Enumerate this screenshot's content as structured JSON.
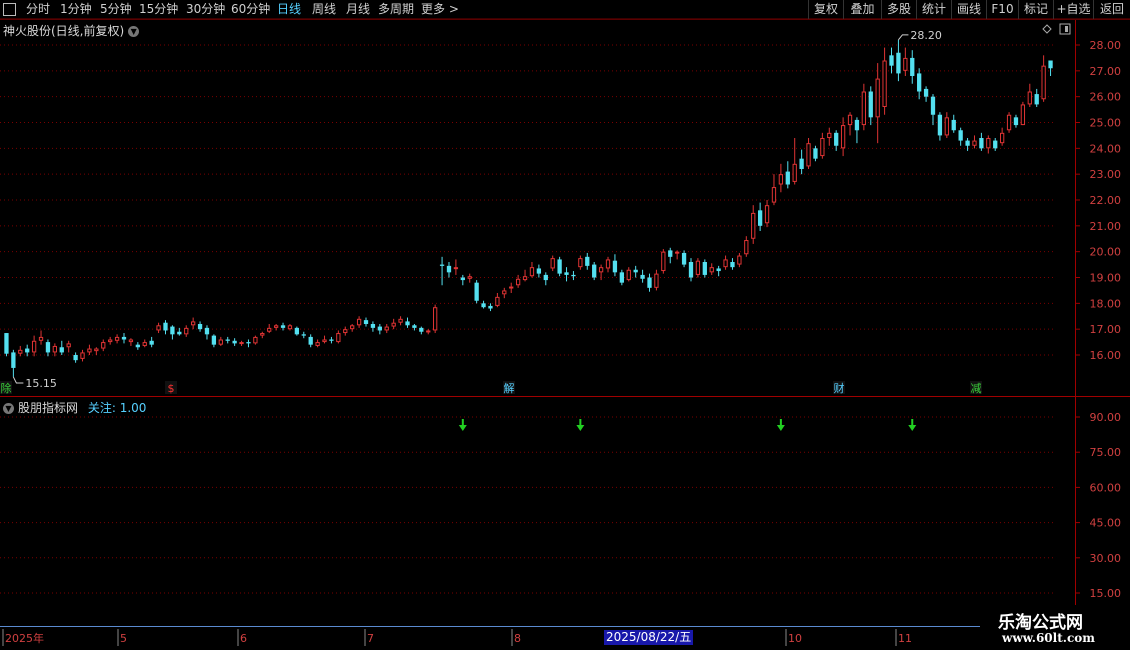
{
  "toolbar": {
    "left": [
      {
        "name": "tab-1min-timeline",
        "label": "分时",
        "active": false
      },
      {
        "name": "tab-1min",
        "label": "1分钟",
        "active": false
      },
      {
        "name": "tab-5min",
        "label": "5分钟",
        "active": false
      },
      {
        "name": "tab-15min",
        "label": "15分钟",
        "active": false
      },
      {
        "name": "tab-30min",
        "label": "30分钟",
        "active": false
      },
      {
        "name": "tab-60min",
        "label": "60分钟",
        "active": false
      },
      {
        "name": "tab-daily",
        "label": "日线",
        "active": true
      },
      {
        "name": "tab-weekly",
        "label": "周线",
        "active": false
      },
      {
        "name": "tab-monthly",
        "label": "月线",
        "active": false
      },
      {
        "name": "tab-multi-period",
        "label": "多周期",
        "active": false
      },
      {
        "name": "tab-more",
        "label": "更多 >",
        "active": false
      }
    ],
    "right": [
      {
        "name": "restore-rights-button",
        "label": "复权"
      },
      {
        "name": "overlay-button",
        "label": "叠加"
      },
      {
        "name": "multi-stock-button",
        "label": "多股"
      },
      {
        "name": "statistics-button",
        "label": "统计"
      },
      {
        "name": "draw-line-button",
        "label": "画线"
      },
      {
        "name": "f10-button",
        "label": "F10"
      },
      {
        "name": "mark-button",
        "label": "标记"
      },
      {
        "name": "add-watchlist-button",
        "label": "+自选"
      },
      {
        "name": "back-button",
        "label": "返回"
      }
    ],
    "menu_icon": "square-menu-icon"
  },
  "main_chart": {
    "title": "神火股份(日线,前复权)",
    "high_label": "28.20",
    "low_label": "15.15",
    "price_axis": [
      "28.00",
      "27.00",
      "26.00",
      "25.00",
      "24.00",
      "23.00",
      "22.00",
      "21.00",
      "20.00",
      "19.00",
      "18.00",
      "17.00",
      "16.00"
    ],
    "event_markers": [
      {
        "label": "除",
        "color": "#3ad03a"
      },
      {
        "label": "$",
        "color": "#ff3333"
      },
      {
        "label": "解",
        "color": "#56d0ff"
      },
      {
        "label": "财",
        "color": "#56d0ff"
      },
      {
        "label": "减",
        "color": "#3ad03a"
      }
    ],
    "up_color": "#e03434",
    "down_color": "#54e0f0"
  },
  "indicator": {
    "title": "股朋指标网",
    "follow_label": "关注:",
    "follow_value": "1.00",
    "axis": [
      "90.00",
      "75.00",
      "60.00",
      "45.00",
      "30.00",
      "15.00"
    ],
    "arrow_color": "#22d022",
    "arrow_count": 4
  },
  "date_axis": {
    "labels": [
      "2025年",
      "5",
      "6",
      "7",
      "8",
      "9",
      "10",
      "11"
    ],
    "highlight": "2025/08/22/五"
  },
  "watermark": {
    "line1": "乐淘公式网",
    "line2": "www.60lt.com"
  },
  "chart_data": {
    "type": "candlestick",
    "title": "神火股份(日线,前复权)",
    "ylim": [
      15.2,
      28.7
    ],
    "candles": [
      [
        16.85,
        16.05,
        16.85,
        15.95
      ],
      [
        16.1,
        15.5,
        16.2,
        15.15
      ],
      [
        16.05,
        16.2,
        16.35,
        15.95
      ],
      [
        16.25,
        16.1,
        16.4,
        15.95
      ],
      [
        16.1,
        16.55,
        16.75,
        15.95
      ],
      [
        16.55,
        16.7,
        16.95,
        16.4
      ],
      [
        16.5,
        16.1,
        16.6,
        15.95
      ],
      [
        16.1,
        16.35,
        16.45,
        15.95
      ],
      [
        16.3,
        16.1,
        16.55,
        16.0
      ],
      [
        16.3,
        16.45,
        16.55,
        16.1
      ],
      [
        16.0,
        15.8,
        16.1,
        15.7
      ],
      [
        15.85,
        16.1,
        16.2,
        15.75
      ],
      [
        16.1,
        16.25,
        16.4,
        16.0
      ],
      [
        16.15,
        16.25,
        16.3,
        16.0
      ],
      [
        16.25,
        16.5,
        16.6,
        16.15
      ],
      [
        16.5,
        16.6,
        16.7,
        16.4
      ],
      [
        16.55,
        16.7,
        16.8,
        16.45
      ],
      [
        16.7,
        16.6,
        16.85,
        16.45
      ],
      [
        16.5,
        16.6,
        16.65,
        16.35
      ],
      [
        16.4,
        16.3,
        16.5,
        16.2
      ],
      [
        16.35,
        16.5,
        16.6,
        16.3
      ],
      [
        16.55,
        16.4,
        16.7,
        16.3
      ],
      [
        16.95,
        17.15,
        17.25,
        16.85
      ],
      [
        17.25,
        16.95,
        17.35,
        16.8
      ],
      [
        17.1,
        16.8,
        17.15,
        16.6
      ],
      [
        16.9,
        16.8,
        17.05,
        16.75
      ],
      [
        16.8,
        17.05,
        17.15,
        16.7
      ],
      [
        17.15,
        17.3,
        17.45,
        17.0
      ],
      [
        17.2,
        17.0,
        17.3,
        16.9
      ],
      [
        17.05,
        16.8,
        17.15,
        16.6
      ],
      [
        16.75,
        16.4,
        16.8,
        16.3
      ],
      [
        16.4,
        16.6,
        16.7,
        16.35
      ],
      [
        16.6,
        16.55,
        16.7,
        16.45
      ],
      [
        16.55,
        16.45,
        16.65,
        16.35
      ],
      [
        16.45,
        16.5,
        16.55,
        16.35
      ],
      [
        16.5,
        16.45,
        16.6,
        16.3
      ],
      [
        16.45,
        16.7,
        16.75,
        16.4
      ],
      [
        16.75,
        16.85,
        16.9,
        16.65
      ],
      [
        16.9,
        17.05,
        17.2,
        16.85
      ],
      [
        17.05,
        17.15,
        17.2,
        16.95
      ],
      [
        17.15,
        17.05,
        17.25,
        16.95
      ],
      [
        17.0,
        17.15,
        17.2,
        16.95
      ],
      [
        17.05,
        16.8,
        17.1,
        16.75
      ],
      [
        16.8,
        16.75,
        16.9,
        16.65
      ],
      [
        16.7,
        16.4,
        16.8,
        16.3
      ],
      [
        16.35,
        16.5,
        16.6,
        16.3
      ],
      [
        16.5,
        16.6,
        16.75,
        16.45
      ],
      [
        16.6,
        16.55,
        16.7,
        16.45
      ],
      [
        16.5,
        16.85,
        16.95,
        16.45
      ],
      [
        16.85,
        17.0,
        17.1,
        16.75
      ],
      [
        17.0,
        17.15,
        17.2,
        16.9
      ],
      [
        17.15,
        17.4,
        17.5,
        17.05
      ],
      [
        17.35,
        17.2,
        17.45,
        17.1
      ],
      [
        17.2,
        17.05,
        17.3,
        16.9
      ],
      [
        17.1,
        16.95,
        17.2,
        16.8
      ],
      [
        16.95,
        17.1,
        17.2,
        16.85
      ],
      [
        17.1,
        17.25,
        17.4,
        17.0
      ],
      [
        17.25,
        17.4,
        17.5,
        17.15
      ],
      [
        17.3,
        17.15,
        17.45,
        17.05
      ],
      [
        17.15,
        17.05,
        17.2,
        16.95
      ],
      [
        17.05,
        16.9,
        17.1,
        16.8
      ],
      [
        16.9,
        16.95,
        17.0,
        16.8
      ],
      [
        16.95,
        17.85,
        17.95,
        16.85
      ],
      [
        19.5,
        19.45,
        19.8,
        18.7
      ],
      [
        19.45,
        19.2,
        19.6,
        19.0
      ],
      [
        19.35,
        19.4,
        19.7,
        19.1
      ],
      [
        19.0,
        18.9,
        19.1,
        18.7
      ],
      [
        18.95,
        19.05,
        19.15,
        18.8
      ],
      [
        18.8,
        18.1,
        18.9,
        18.0
      ],
      [
        18.0,
        17.85,
        18.1,
        17.8
      ],
      [
        17.9,
        17.8,
        18.0,
        17.7
      ],
      [
        17.9,
        18.25,
        18.4,
        17.85
      ],
      [
        18.35,
        18.5,
        18.6,
        18.2
      ],
      [
        18.6,
        18.65,
        18.8,
        18.4
      ],
      [
        18.7,
        18.95,
        19.1,
        18.6
      ],
      [
        18.9,
        19.05,
        19.3,
        18.85
      ],
      [
        19.05,
        19.4,
        19.6,
        19.0
      ],
      [
        19.35,
        19.15,
        19.5,
        19.0
      ],
      [
        19.1,
        18.9,
        19.2,
        18.7
      ],
      [
        19.35,
        19.75,
        19.85,
        19.25
      ],
      [
        19.7,
        19.15,
        19.8,
        19.05
      ],
      [
        19.2,
        19.1,
        19.4,
        18.85
      ],
      [
        19.1,
        19.05,
        19.25,
        18.9
      ],
      [
        19.4,
        19.75,
        19.85,
        19.3
      ],
      [
        19.8,
        19.45,
        19.95,
        19.3
      ],
      [
        19.5,
        19.0,
        19.6,
        18.9
      ],
      [
        19.2,
        19.4,
        19.5,
        18.9
      ],
      [
        19.35,
        19.7,
        19.8,
        19.2
      ],
      [
        19.65,
        19.2,
        19.9,
        19.05
      ],
      [
        19.2,
        18.8,
        19.3,
        18.7
      ],
      [
        18.9,
        19.3,
        19.4,
        18.85
      ],
      [
        19.3,
        19.2,
        19.45,
        19.0
      ],
      [
        19.1,
        18.95,
        19.3,
        18.8
      ],
      [
        19.0,
        18.6,
        19.15,
        18.45
      ],
      [
        18.6,
        19.15,
        19.3,
        18.5
      ],
      [
        19.25,
        20.0,
        20.1,
        19.15
      ],
      [
        20.05,
        19.8,
        20.15,
        19.55
      ],
      [
        19.95,
        20.0,
        20.05,
        19.7
      ],
      [
        19.95,
        19.5,
        20.05,
        19.4
      ],
      [
        19.6,
        19.0,
        19.75,
        18.85
      ],
      [
        19.1,
        19.65,
        19.75,
        19.0
      ],
      [
        19.6,
        19.1,
        19.7,
        19.0
      ],
      [
        19.2,
        19.4,
        19.55,
        19.1
      ],
      [
        19.35,
        19.25,
        19.45,
        19.05
      ],
      [
        19.4,
        19.7,
        19.85,
        19.3
      ],
      [
        19.6,
        19.4,
        19.75,
        19.3
      ],
      [
        19.5,
        19.85,
        19.95,
        19.4
      ],
      [
        19.9,
        20.45,
        20.6,
        19.8
      ],
      [
        20.5,
        21.5,
        21.8,
        20.3
      ],
      [
        21.6,
        21.0,
        21.9,
        20.8
      ],
      [
        21.1,
        21.8,
        22.0,
        20.95
      ],
      [
        21.9,
        22.5,
        23.0,
        21.8
      ],
      [
        22.6,
        23.0,
        23.4,
        22.3
      ],
      [
        23.1,
        22.6,
        23.5,
        22.45
      ],
      [
        22.7,
        23.4,
        24.4,
        22.6
      ],
      [
        23.6,
        23.2,
        23.95,
        23.0
      ],
      [
        23.3,
        24.2,
        24.4,
        23.2
      ],
      [
        24.0,
        23.6,
        24.1,
        23.5
      ],
      [
        23.7,
        24.4,
        24.6,
        23.6
      ],
      [
        24.4,
        24.6,
        24.8,
        24.1
      ],
      [
        24.6,
        24.1,
        24.7,
        23.9
      ],
      [
        24.0,
        24.9,
        25.2,
        23.7
      ],
      [
        24.9,
        25.3,
        25.4,
        24.5
      ],
      [
        25.1,
        24.7,
        25.2,
        24.2
      ],
      [
        24.9,
        26.2,
        26.5,
        24.7
      ],
      [
        26.2,
        25.2,
        26.4,
        24.9
      ],
      [
        25.2,
        26.7,
        27.3,
        24.2
      ],
      [
        25.6,
        27.4,
        27.9,
        25.3
      ],
      [
        27.6,
        27.2,
        27.9,
        26.9
      ],
      [
        27.7,
        26.9,
        28.2,
        26.6
      ],
      [
        27.0,
        27.5,
        27.9,
        26.8
      ],
      [
        27.5,
        26.8,
        27.8,
        26.5
      ],
      [
        26.9,
        26.2,
        27.1,
        25.9
      ],
      [
        26.3,
        26.0,
        26.4,
        25.8
      ],
      [
        26.0,
        25.3,
        26.1,
        24.9
      ],
      [
        25.3,
        24.5,
        25.4,
        24.3
      ],
      [
        24.5,
        25.2,
        25.4,
        24.4
      ],
      [
        25.1,
        24.7,
        25.3,
        24.6
      ],
      [
        24.7,
        24.3,
        24.8,
        24.1
      ],
      [
        24.3,
        24.1,
        24.4,
        23.9
      ],
      [
        24.1,
        24.3,
        24.5,
        24.0
      ],
      [
        24.4,
        24.0,
        24.6,
        23.9
      ],
      [
        24.0,
        24.4,
        24.5,
        23.8
      ],
      [
        24.3,
        24.0,
        24.4,
        23.9
      ],
      [
        24.2,
        24.6,
        24.8,
        24.1
      ],
      [
        24.7,
        25.3,
        25.4,
        24.6
      ],
      [
        25.2,
        24.9,
        25.3,
        24.8
      ],
      [
        24.9,
        25.7,
        25.8,
        24.9
      ],
      [
        25.7,
        26.2,
        26.5,
        25.6
      ],
      [
        26.1,
        25.7,
        26.3,
        25.6
      ],
      [
        25.9,
        27.2,
        27.6,
        25.8
      ],
      [
        27.4,
        27.1,
        27.4,
        26.8
      ]
    ],
    "indicator_arrows_at": [
      66,
      83,
      112,
      131
    ]
  }
}
